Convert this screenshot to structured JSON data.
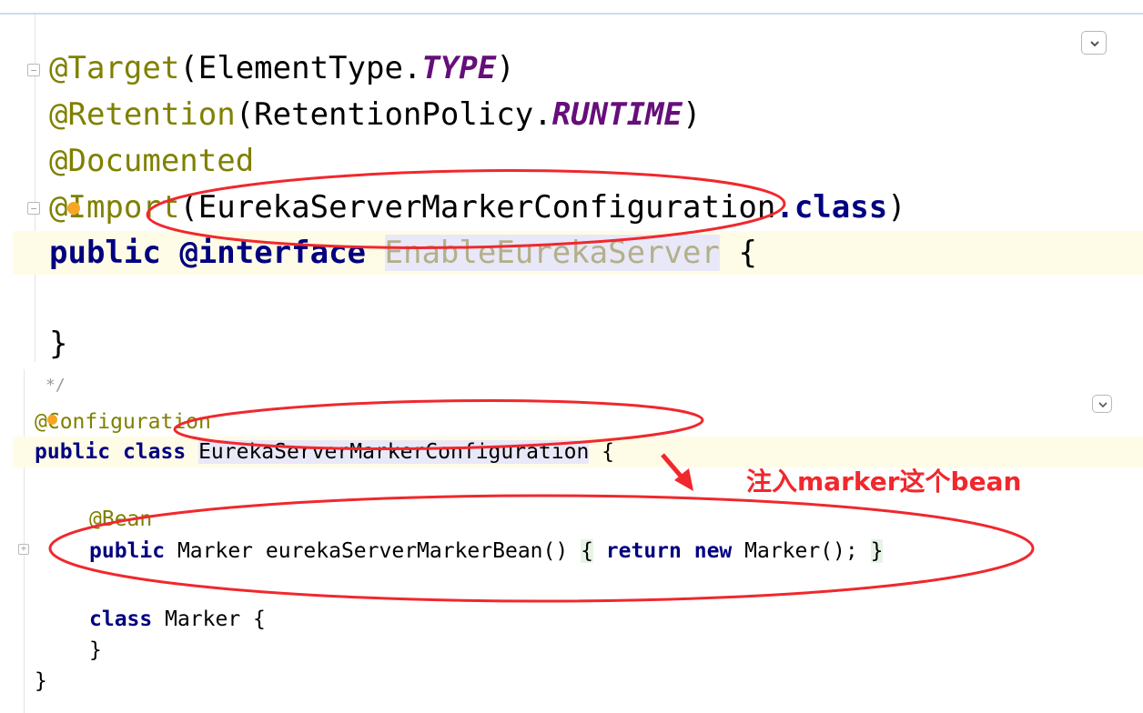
{
  "top": {
    "lines": [
      {
        "parts": [
          "@Target",
          "(ElementType.",
          "TYPE",
          ")"
        ]
      },
      {
        "parts": [
          "@Retention",
          "(RetentionPolicy.",
          "RUNTIME",
          ")"
        ]
      },
      {
        "parts": [
          "@Documented"
        ]
      },
      {
        "parts": [
          "@",
          "Import",
          "(EurekaServerMarkerConfiguration",
          ".class",
          ")"
        ]
      },
      {
        "parts": [
          "public",
          " ",
          "@interface",
          " ",
          "EnableEurekaServer",
          " {"
        ]
      },
      {
        "parts": [
          "}"
        ]
      }
    ]
  },
  "bottom": {
    "truncated_comment": "*/",
    "lines": [
      {
        "parts": [
          "@",
          "Configuration"
        ]
      },
      {
        "parts": [
          "public",
          " ",
          "class",
          " ",
          "EurekaServerMarkerConfiguration",
          " {"
        ]
      },
      {
        "parts": [
          "@Bean"
        ]
      },
      {
        "parts": [
          "public",
          " Marker eurekaServerMarkerBean() ",
          "{",
          " ",
          "return",
          " ",
          "new",
          " Marker(); ",
          "}"
        ]
      },
      {
        "parts": [
          "class",
          " Marker {"
        ]
      },
      {
        "parts": [
          "}"
        ]
      },
      {
        "parts": [
          "}"
        ]
      }
    ]
  },
  "annotation_note": "注入marker这个bean",
  "icons": [
    "collapse-chevron-icon",
    "fold-icon",
    "intention-bulb-icon",
    "arrow-icon"
  ],
  "colors": {
    "annotation": "#808000",
    "keyword": "#000080",
    "constant": "#660e7a",
    "markup_red": "#f0282d",
    "caret_row": "#fefce6"
  }
}
